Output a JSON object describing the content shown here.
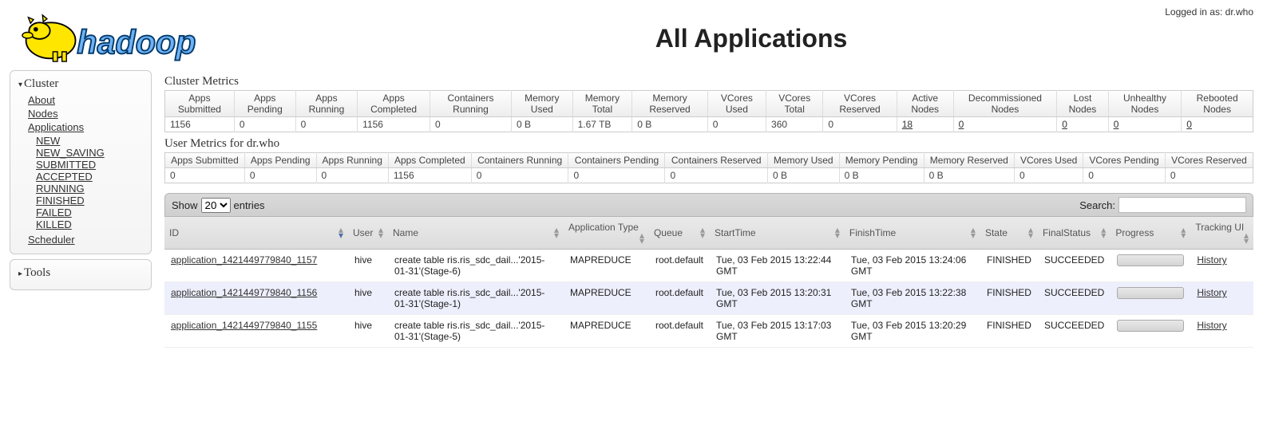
{
  "login": {
    "prefix": "Logged in as: ",
    "user": "dr.who"
  },
  "logo_text": "hadoop",
  "page_title": "All Applications",
  "sidebar": {
    "cluster_label": "Cluster",
    "tools_label": "Tools",
    "items": {
      "about": "About",
      "nodes": "Nodes",
      "applications": "Applications",
      "scheduler": "Scheduler"
    },
    "app_states": {
      "new": "NEW",
      "new_saving": "NEW_SAVING",
      "submitted": "SUBMITTED",
      "accepted": "ACCEPTED",
      "running": "RUNNING",
      "finished": "FINISHED",
      "failed": "FAILED",
      "killed": "KILLED"
    }
  },
  "sections": {
    "cluster_metrics": "Cluster Metrics",
    "user_metrics_prefix": "User Metrics for ",
    "user_metrics_user": "dr.who"
  },
  "cluster_metrics": {
    "headers": [
      "Apps Submitted",
      "Apps Pending",
      "Apps Running",
      "Apps Completed",
      "Containers Running",
      "Memory Used",
      "Memory Total",
      "Memory Reserved",
      "VCores Used",
      "VCores Total",
      "VCores Reserved",
      "Active Nodes",
      "Decommissioned Nodes",
      "Lost Nodes",
      "Unhealthy Nodes",
      "Rebooted Nodes"
    ],
    "values": [
      "1156",
      "0",
      "0",
      "1156",
      "0",
      "0 B",
      "1.67 TB",
      "0 B",
      "0",
      "360",
      "0",
      "18",
      "0",
      "0",
      "0",
      "0"
    ],
    "linked": [
      11,
      12,
      13,
      14,
      15
    ]
  },
  "user_metrics": {
    "headers": [
      "Apps Submitted",
      "Apps Pending",
      "Apps Running",
      "Apps Completed",
      "Containers Running",
      "Containers Pending",
      "Containers Reserved",
      "Memory Used",
      "Memory Pending",
      "Memory Reserved",
      "VCores Used",
      "VCores Pending",
      "VCores Reserved"
    ],
    "values": [
      "0",
      "0",
      "0",
      "1156",
      "0",
      "0",
      "0",
      "0 B",
      "0 B",
      "0 B",
      "0",
      "0",
      "0"
    ]
  },
  "toolbar": {
    "show_label": "Show",
    "entries_label": "entries",
    "page_size": "20",
    "search_label": "Search:"
  },
  "apps_table": {
    "columns": [
      "ID",
      "User",
      "Name",
      "Application Type",
      "Queue",
      "StartTime",
      "FinishTime",
      "State",
      "FinalStatus",
      "Progress",
      "Tracking UI"
    ],
    "rows": [
      {
        "id": "application_1421449779840_1157",
        "user": "hive",
        "name": "create table ris.ris_sdc_dail...'2015-01-31'(Stage-6)",
        "app_type": "MAPREDUCE",
        "queue": "root.default",
        "start": "Tue, 03 Feb 2015 13:22:44 GMT",
        "finish": "Tue, 03 Feb 2015 13:24:06 GMT",
        "state": "FINISHED",
        "final": "SUCCEEDED",
        "tracking": "History"
      },
      {
        "id": "application_1421449779840_1156",
        "user": "hive",
        "name": "create table ris.ris_sdc_dail...'2015-01-31'(Stage-1)",
        "app_type": "MAPREDUCE",
        "queue": "root.default",
        "start": "Tue, 03 Feb 2015 13:20:31 GMT",
        "finish": "Tue, 03 Feb 2015 13:22:38 GMT",
        "state": "FINISHED",
        "final": "SUCCEEDED",
        "tracking": "History"
      },
      {
        "id": "application_1421449779840_1155",
        "user": "hive",
        "name": "create table ris.ris_sdc_dail...'2015-01-31'(Stage-5)",
        "app_type": "MAPREDUCE",
        "queue": "root.default",
        "start": "Tue, 03 Feb 2015 13:17:03 GMT",
        "finish": "Tue, 03 Feb 2015 13:20:29 GMT",
        "state": "FINISHED",
        "final": "SUCCEEDED",
        "tracking": "History"
      }
    ]
  }
}
